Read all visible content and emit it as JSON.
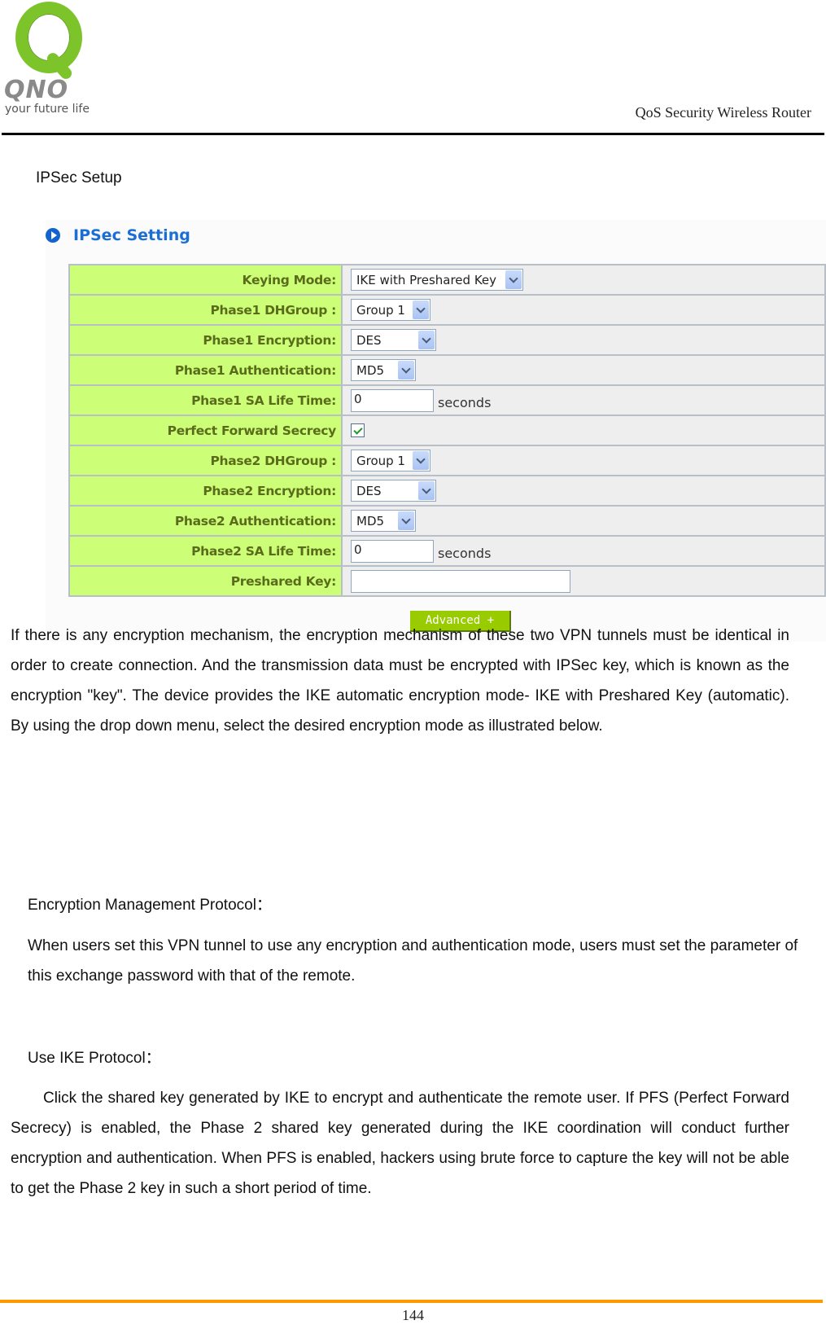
{
  "header": {
    "logo_brand": "QNO",
    "logo_tagline": "your future life",
    "product_name": "QoS Security Wireless Router"
  },
  "section_heading": "IPSec Setup",
  "ipsec_panel": {
    "title": "IPSec Setting",
    "rows": [
      {
        "label": "Keying Mode:",
        "type": "select",
        "value": "IKE with Preshared Key"
      },
      {
        "label": "Phase1 DHGroup :",
        "type": "select",
        "value": "Group 1"
      },
      {
        "label": "Phase1 Encryption:",
        "type": "select",
        "value": "DES"
      },
      {
        "label": "Phase1 Authentication:",
        "type": "select",
        "value": "MD5"
      },
      {
        "label": "Phase1 SA Life Time:",
        "type": "text",
        "value": "0",
        "unit": "seconds"
      },
      {
        "label": "Perfect Forward Secrecy",
        "type": "checkbox",
        "checked": true
      },
      {
        "label": "Phase2 DHGroup :",
        "type": "select",
        "value": "Group 1"
      },
      {
        "label": "Phase2 Encryption:",
        "type": "select",
        "value": "DES"
      },
      {
        "label": "Phase2 Authentication:",
        "type": "select",
        "value": "MD5"
      },
      {
        "label": "Phase2 SA Life Time:",
        "type": "text",
        "value": "0",
        "unit": "seconds"
      },
      {
        "label": "Preshared Key:",
        "type": "text",
        "value": ""
      }
    ],
    "advanced_button": "Advanced +"
  },
  "body": {
    "paragraph_1": "If there is any encryption mechanism, the encryption mechanism of these two VPN tunnels must be identical in order to create connection. And the transmission data must be encrypted with IPSec key, which is known as the encryption \"key\". The device provides the IKE automatic encryption mode- IKE with Preshared Key (automatic). By using the drop down menu, select the desired encryption mode as illustrated below.",
    "heading_encryption_mgmt": "Encryption Management Protocol：",
    "paragraph_2": "When users set this VPN tunnel to use any encryption and authentication mode, users must set the parameter of this exchange password with that of the remote.",
    "heading_use_ike": "Use IKE Protocol：",
    "paragraph_3": "Click the shared key generated by IKE to encrypt and authenticate the remote user. If PFS (Perfect Forward Secrecy) is enabled, the Phase 2 shared key generated during the IKE coordination will conduct further encryption and authentication. When PFS is enabled, hackers using brute force to capture the key will not be able to get the Phase 2 key in such a short period of time."
  },
  "footer": {
    "page_number": "144"
  },
  "colors": {
    "logo_green": "#7cc42a",
    "label_cell_bg": "#ccff77",
    "label_text": "#5a6c1c",
    "panel_title": "#1a6fd6",
    "advanced_button_bg": "#99cc00",
    "footer_rule": "#ff9900"
  }
}
